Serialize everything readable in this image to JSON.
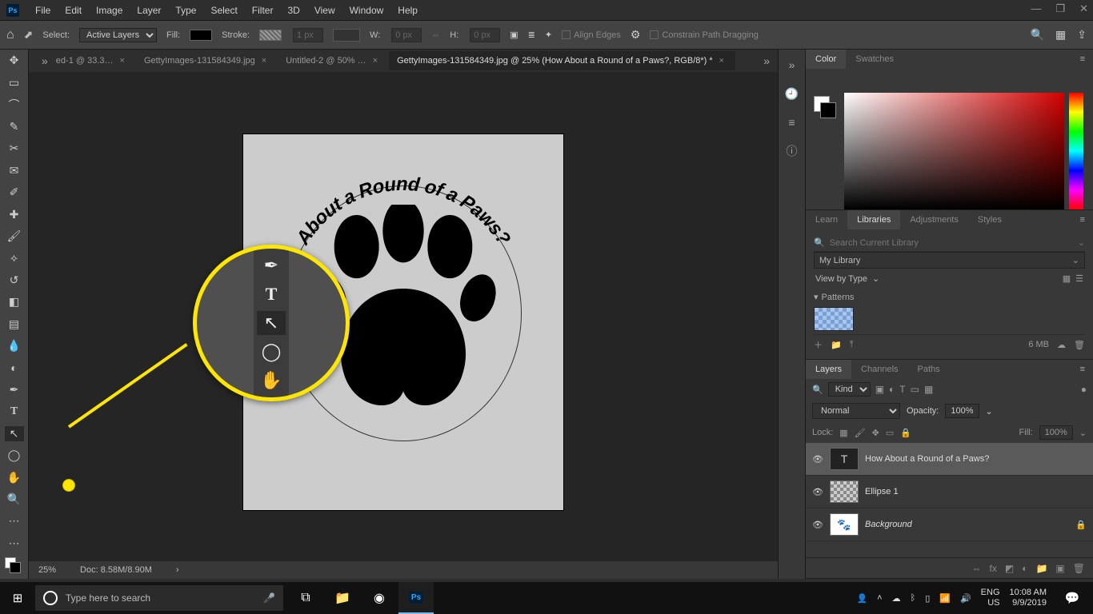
{
  "menubar": [
    "File",
    "Edit",
    "Image",
    "Layer",
    "Type",
    "Select",
    "Filter",
    "3D",
    "View",
    "Window",
    "Help"
  ],
  "optionsbar": {
    "select_label": "Select:",
    "select_value": "Active Layers",
    "fill_label": "Fill:",
    "stroke_label": "Stroke:",
    "stroke_px": "1 px",
    "w_label": "W:",
    "w_value": "0 px",
    "h_label": "H:",
    "h_value": "0 px",
    "align_edges": "Align Edges",
    "constrain": "Constrain Path Dragging"
  },
  "tabs": [
    {
      "label": "ed-1 @ 33.3…",
      "active": false
    },
    {
      "label": "GettyImages-131584349.jpg",
      "active": false
    },
    {
      "label": "Untitled-2 @ 50% …",
      "active": false
    },
    {
      "label": "GettyImages-131584349.jpg @ 25% (How About a Round of a Paws?, RGB/8*) *",
      "active": true
    }
  ],
  "canvas_text": "About a Round of a Paws?",
  "statusbar": {
    "zoom": "25%",
    "doc": "Doc: 8.58M/8.90M"
  },
  "color_tabs": [
    "Color",
    "Swatches"
  ],
  "lib_tabs": [
    "Learn",
    "Libraries",
    "Adjustments",
    "Styles"
  ],
  "lib": {
    "search_placeholder": "Search Current Library",
    "my_library": "My Library",
    "view_by": "View by Type",
    "patterns": "Patterns",
    "size": "6 MB"
  },
  "layers_tabs": [
    "Layers",
    "Channels",
    "Paths"
  ],
  "layers": {
    "kind_label": "Kind",
    "blend_mode": "Normal",
    "opacity_label": "Opacity:",
    "opacity_value": "100%",
    "lock_label": "Lock:",
    "fill_label": "Fill:",
    "fill_value": "100%",
    "items": [
      {
        "name": "How About a Round of a Paws?",
        "type": "T",
        "selected": true
      },
      {
        "name": "Ellipse 1",
        "type": "shape",
        "selected": false
      },
      {
        "name": "Background",
        "type": "image",
        "selected": false,
        "italic": true,
        "locked": true
      }
    ]
  },
  "taskbar": {
    "search_placeholder": "Type here to search",
    "lang": "ENG",
    "kb": "US",
    "time": "10:08 AM",
    "date": "9/9/2019"
  }
}
